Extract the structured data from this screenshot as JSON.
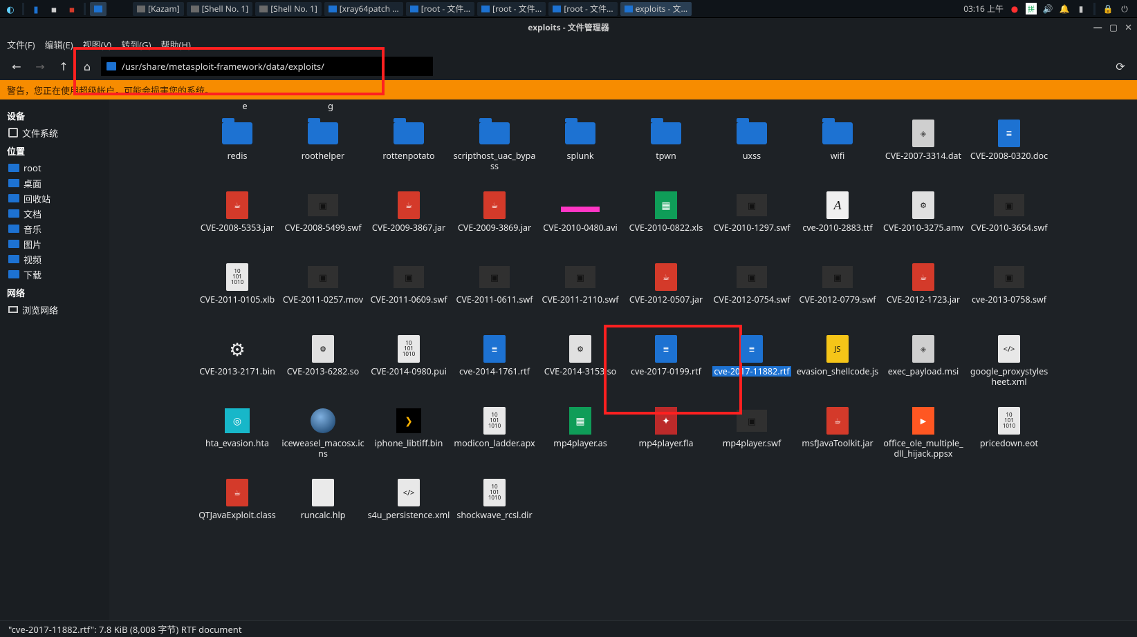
{
  "taskbar": {
    "items": [
      {
        "label": "[Kazam]"
      },
      {
        "label": "[Shell No. 1]"
      },
      {
        "label": "[Shell No. 1]"
      },
      {
        "label": "[xray64patch ..."
      },
      {
        "label": "[root - 文件..."
      },
      {
        "label": "[root - 文件..."
      },
      {
        "label": "[root - 文件..."
      },
      {
        "label": "exploits - 文..."
      }
    ],
    "clock": "03:16 上午"
  },
  "window": {
    "title": "exploits - 文件管理器"
  },
  "menu": {
    "file": "文件(F)",
    "edit": "编辑(E)",
    "view": "视图(V)",
    "go": "转到(G)",
    "help": "帮助(H)"
  },
  "address": "/usr/share/metasploit-framework/data/exploits/",
  "warning": "警告，您正在使用超级帐户，可能会损害您的系统。",
  "sidebar": {
    "devices": "设备",
    "devices_items": [
      {
        "label": "文件系统",
        "icon": "hdd"
      }
    ],
    "places": "位置",
    "places_items": [
      {
        "label": "root",
        "icon": "fld"
      },
      {
        "label": "桌面",
        "icon": "fld"
      },
      {
        "label": "回收站",
        "icon": "fld"
      },
      {
        "label": "文档",
        "icon": "fld"
      },
      {
        "label": "音乐",
        "icon": "fld"
      },
      {
        "label": "图片",
        "icon": "fld"
      },
      {
        "label": "视频",
        "icon": "fld"
      },
      {
        "label": "下载",
        "icon": "fld"
      }
    ],
    "network": "网络",
    "network_items": [
      {
        "label": "浏览网络",
        "icon": "net"
      }
    ]
  },
  "residual": {
    "c2": "e",
    "c3": "g"
  },
  "files": [
    {
      "name": "redis",
      "icon": "folder"
    },
    {
      "name": "roothelper",
      "icon": "folder"
    },
    {
      "name": "rottenpotato",
      "icon": "folder"
    },
    {
      "name": "scripthost_uac_bypass",
      "icon": "folder"
    },
    {
      "name": "splunk",
      "icon": "folder"
    },
    {
      "name": "tpwn",
      "icon": "folder"
    },
    {
      "name": "uxss",
      "icon": "folder"
    },
    {
      "name": "wifi",
      "icon": "folder"
    },
    {
      "name": "CVE-2007-3314.dat",
      "icon": "diamond"
    },
    {
      "name": "CVE-2008-0320.doc",
      "icon": "doc"
    },
    {
      "name": "CVE-2008-5353.jar",
      "icon": "jar"
    },
    {
      "name": "CVE-2008-5499.swf",
      "icon": "video"
    },
    {
      "name": "CVE-2009-3867.jar",
      "icon": "jar"
    },
    {
      "name": "CVE-2009-3869.jar",
      "icon": "jar"
    },
    {
      "name": "CVE-2010-0480.avi",
      "icon": "pink"
    },
    {
      "name": "CVE-2010-0822.xls",
      "icon": "sheet"
    },
    {
      "name": "CVE-2010-1297.swf",
      "icon": "video"
    },
    {
      "name": "cve-2010-2883.ttf",
      "icon": "font"
    },
    {
      "name": "CVE-2010-3275.amv",
      "icon": "gear"
    },
    {
      "name": "CVE-2010-3654.swf",
      "icon": "video"
    },
    {
      "name": "CVE-2011-0105.xlb",
      "icon": "bin"
    },
    {
      "name": "CVE-2011-0257.mov",
      "icon": "video"
    },
    {
      "name": "CVE-2011-0609.swf",
      "icon": "video"
    },
    {
      "name": "CVE-2011-0611.swf",
      "icon": "video"
    },
    {
      "name": "CVE-2011-2110.swf",
      "icon": "video"
    },
    {
      "name": "CVE-2012-0507.jar",
      "icon": "jar"
    },
    {
      "name": "CVE-2012-0754.swf",
      "icon": "video"
    },
    {
      "name": "CVE-2012-0779.swf",
      "icon": "video"
    },
    {
      "name": "CVE-2012-1723.jar",
      "icon": "jar"
    },
    {
      "name": "cve-2013-0758.swf",
      "icon": "video"
    },
    {
      "name": "CVE-2013-2171.bin",
      "icon": "cog"
    },
    {
      "name": "CVE-2013-6282.so",
      "icon": "gear"
    },
    {
      "name": "CVE-2014-0980.pui",
      "icon": "bin"
    },
    {
      "name": "cve-2014-1761.rtf",
      "icon": "doc"
    },
    {
      "name": "CVE-2014-3153.so",
      "icon": "gear"
    },
    {
      "name": "cve-2017-0199.rtf",
      "icon": "doc"
    },
    {
      "name": "cve-2017-11882.rtf",
      "icon": "doc",
      "selected": true
    },
    {
      "name": "evasion_shellcode.js",
      "icon": "js"
    },
    {
      "name": "exec_payload.msi",
      "icon": "diamond"
    },
    {
      "name": "google_proxystylesheet.xml",
      "icon": "xml"
    },
    {
      "name": "hta_evasion.hta",
      "icon": "square"
    },
    {
      "name": "iceweasel_macosx.icns",
      "icon": "orb"
    },
    {
      "name": "iphone_libtiff.bin",
      "icon": "phone"
    },
    {
      "name": "modicon_ladder.apx",
      "icon": "bin"
    },
    {
      "name": "mp4player.as",
      "icon": "sheet"
    },
    {
      "name": "mp4player.fla",
      "icon": "fla"
    },
    {
      "name": "mp4player.swf",
      "icon": "video"
    },
    {
      "name": "msfJavaToolkit.jar",
      "icon": "jar"
    },
    {
      "name": "office_ole_multiple_dll_hijack.ppsx",
      "icon": "ppsx"
    },
    {
      "name": "pricedown.eot",
      "icon": "bin"
    },
    {
      "name": "QTJavaExploit.class",
      "icon": "jar"
    },
    {
      "name": "runcalc.hlp",
      "icon": "file"
    },
    {
      "name": "s4u_persistence.xml",
      "icon": "xml"
    },
    {
      "name": "shockwave_rcsl.dir",
      "icon": "bin"
    }
  ],
  "status": "\"cve-2017-11882.rtf\": 7.8 KiB (8,008 字节) RTF document"
}
